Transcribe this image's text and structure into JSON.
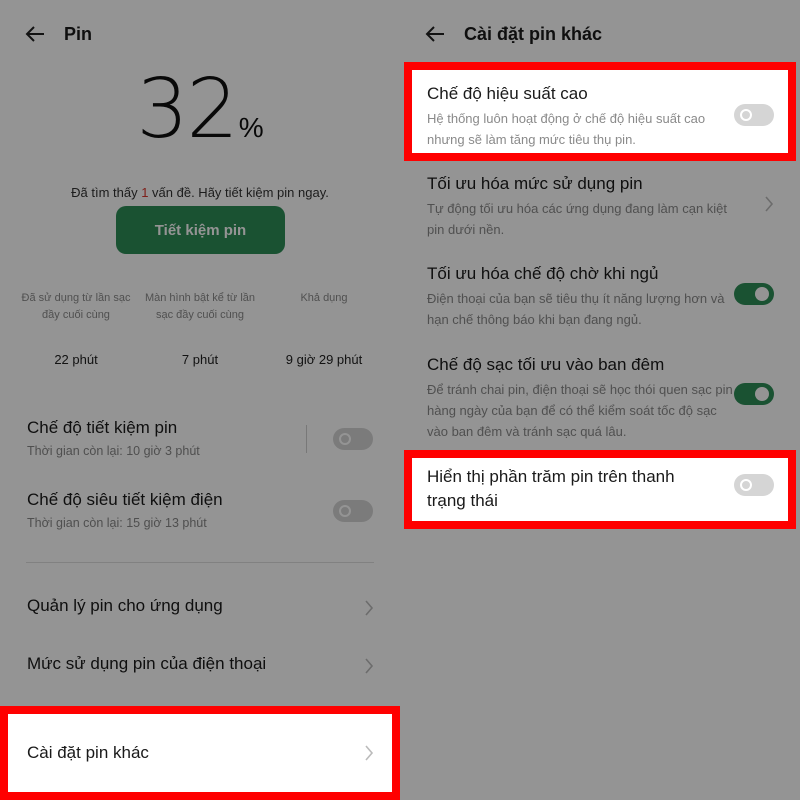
{
  "left": {
    "header": {
      "title": "Pin"
    },
    "battery": {
      "percent": "32",
      "unit": "%"
    },
    "issue": {
      "prefix": "Đã tìm thấy ",
      "count": "1",
      "suffix": " vấn đề. Hãy tiết kiệm pin ngay."
    },
    "save_button": "Tiết kiệm pin",
    "stats": [
      {
        "label": "Đã sử dụng từ lần sạc đầy cuối cùng",
        "value": "22 phút"
      },
      {
        "label": "Màn hình bật kể từ lần sạc đầy cuối cùng",
        "value": "7 phút"
      },
      {
        "label": "Khả dụng",
        "value": "9 giờ 29 phút"
      }
    ],
    "power_saving": {
      "title": "Chế độ tiết kiệm pin",
      "subtitle": "Thời gian còn lại:  10 giờ 3 phút"
    },
    "super_saving": {
      "title": "Chế độ siêu tiết kiệm điện",
      "subtitle": "Thời gian còn lại:  15 giờ 13 phút"
    },
    "app_battery": {
      "title": "Quản lý pin cho ứng dụng"
    },
    "phone_usage": {
      "title": "Mức sử dụng pin của điện thoại"
    },
    "other_settings": {
      "title": "Cài đặt pin khác"
    }
  },
  "right": {
    "header": {
      "title": "Cài đặt pin khác"
    },
    "high_performance": {
      "title": "Chế độ hiệu suất cao",
      "subtitle": "Hệ thống luôn hoạt động ở chế độ hiệu suất cao nhưng sẽ làm tăng mức tiêu thụ pin.",
      "on": false
    },
    "optimize_usage": {
      "title": "Tối ưu hóa mức sử dụng pin",
      "subtitle": "Tự động tối ưu hóa các ứng dụng đang làm cạn kiệt pin dưới nền."
    },
    "sleep_standby": {
      "title": "Tối ưu hóa chế độ chờ khi ngủ",
      "subtitle": "Điện thoại của bạn sẽ tiêu thụ ít năng lượng hơn và hạn chế thông báo khi bạn đang ngủ.",
      "on": true
    },
    "night_charging": {
      "title": "Chế độ sạc tối ưu vào ban đêm",
      "subtitle": "Để tránh chai pin, điện thoại sẽ học thói quen sạc pin hàng ngày của bạn để có thể kiểm soát tốc độ sạc vào ban đêm và tránh sạc quá lâu.",
      "on": true
    },
    "show_percent": {
      "title": "Hiển thị phần trăm pin trên thanh trạng thái",
      "on": false
    }
  },
  "colors": {
    "accent_green": "#2e8d57",
    "highlight_red": "#ff0000",
    "issue_red": "#d9342b"
  }
}
